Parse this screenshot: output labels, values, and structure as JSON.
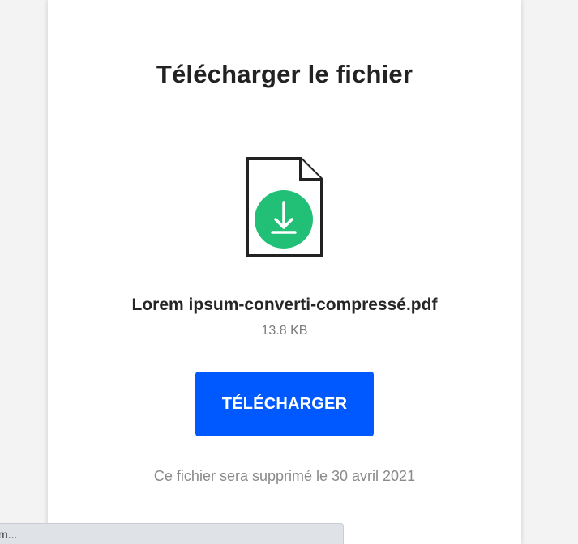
{
  "title": "Télécharger le fichier",
  "file": {
    "name": "Lorem ipsum-converti-compressé.pdf",
    "size": "13.8 KB",
    "icon": "file-download-icon"
  },
  "actions": {
    "download_label": "TÉLÉCHARGER"
  },
  "notice": "Ce fichier sera supprimé le 30 avril 2021",
  "status_bar": {
    "text": "m..."
  },
  "colors": {
    "accent": "#0059ff",
    "download_circle": "#22c076",
    "text": "#222222",
    "muted": "#8a8a8a"
  }
}
